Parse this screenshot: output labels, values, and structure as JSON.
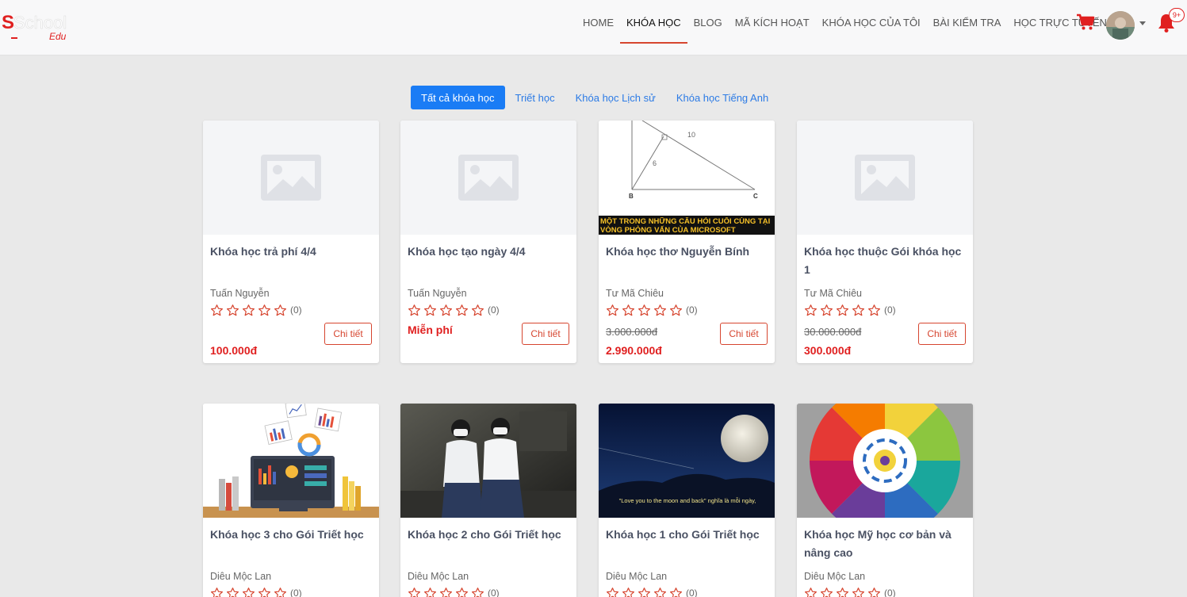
{
  "header": {
    "logo_text": "School",
    "logo_sub": "Edu",
    "nav": [
      {
        "label": "HOME",
        "active": false
      },
      {
        "label": "KHÓA HỌC",
        "active": true
      },
      {
        "label": "BLOG",
        "active": false
      },
      {
        "label": "MÃ KÍCH HOẠT",
        "active": false
      },
      {
        "label": "KHÓA HỌC CỦA TÔI",
        "active": false
      },
      {
        "label": "BÀI KIỂM TRA",
        "active": false
      },
      {
        "label": "HỌC TRỰC TUYẾN",
        "active": false
      }
    ],
    "notification_badge": "9+",
    "accent_color": "#e02020"
  },
  "tabs": [
    {
      "label": "Tất cả khóa học",
      "active": true
    },
    {
      "label": "Triết học",
      "active": false
    },
    {
      "label": "Khóa học Lịch sử",
      "active": false
    },
    {
      "label": "Khóa học Tiếng Anh",
      "active": false
    }
  ],
  "courses": [
    {
      "title": "Khóa học trả phí 4/4",
      "author": "Tuấn Nguyễn",
      "rating_count": "(0)",
      "old_price": "",
      "price": "100.000đ",
      "button": "Chi tiết",
      "image": "placeholder"
    },
    {
      "title": "Khóa học tạo ngày 4/4",
      "author": "Tuấn Nguyễn",
      "rating_count": "(0)",
      "old_price": "",
      "price": "Miễn phí",
      "button": "Chi tiết",
      "image": "placeholder"
    },
    {
      "title": "Khóa học thơ Nguyễn Bính",
      "author": "Tư Mã Chiêu",
      "rating_count": "(0)",
      "old_price": "3.000.000đ",
      "price": "2.990.000đ",
      "button": "Chi tiết",
      "image": "triangle",
      "image_text": "MỘT TRONG NHỮNG CÂU HỎI CUỐI CÙNG TẠI VÒNG PHỎNG VẤN CỦA MICROSOFT"
    },
    {
      "title": "Khóa học thuộc Gói khóa học 1",
      "author": "Tư Mã Chiêu",
      "rating_count": "(0)",
      "old_price": "30.000.000đ",
      "price": "300.000đ",
      "button": "Chi tiết",
      "image": "placeholder"
    },
    {
      "title": "Khóa học 3 cho Gói Triết học",
      "author": "Diêu Mộc Lan",
      "rating_count": "(0)",
      "image": "analytics"
    },
    {
      "title": "Khóa học 2 cho Gói Triết học",
      "author": "Diêu Mộc Lan",
      "rating_count": "(0)",
      "image": "students"
    },
    {
      "title": "Khóa học 1 cho Gói Triết học",
      "author": "Diêu Mộc Lan",
      "rating_count": "(0)",
      "image": "moon",
      "image_text": "\"Love you to the moon and back\" nghĩa là mỗi ngày,"
    },
    {
      "title": "Khóa học Mỹ học cơ bản và nâng cao",
      "author": "Diêu Mộc Lan",
      "rating_count": "(0)",
      "image": "colorwheel"
    }
  ]
}
